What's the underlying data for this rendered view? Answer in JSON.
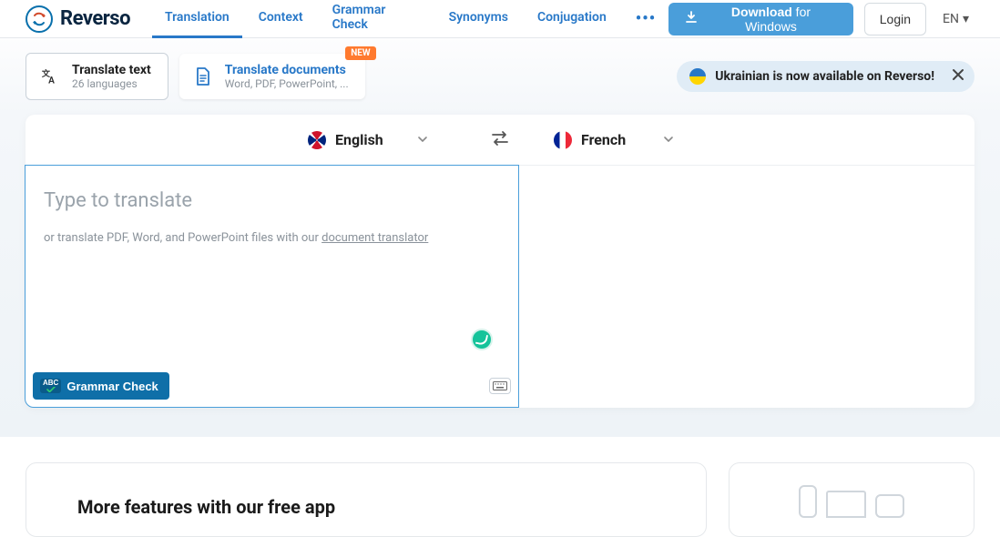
{
  "header": {
    "brand": "Reverso",
    "nav": [
      "Translation",
      "Context",
      "Grammar Check",
      "Synonyms",
      "Conjugation"
    ],
    "download_bold": "Download",
    "download_rest": " for Windows",
    "login": "Login",
    "ui_lang": "EN"
  },
  "modes": {
    "text": {
      "title": "Translate text",
      "sub": "26 languages"
    },
    "docs": {
      "title": "Translate documents",
      "sub": "Word, PDF, PowerPoint, ...",
      "badge": "NEW"
    }
  },
  "banner": {
    "text": "Ukrainian is now available on Reverso!"
  },
  "langs": {
    "src": "English",
    "tgt": "French"
  },
  "input": {
    "placeholder": "Type to translate",
    "hint_prefix": "or translate PDF, Word, and PowerPoint files with our ",
    "hint_link": "document translator"
  },
  "grammar_btn": {
    "icon_label": "ABC",
    "label": "Grammar Check"
  },
  "features": {
    "title": "More features with our free app"
  }
}
